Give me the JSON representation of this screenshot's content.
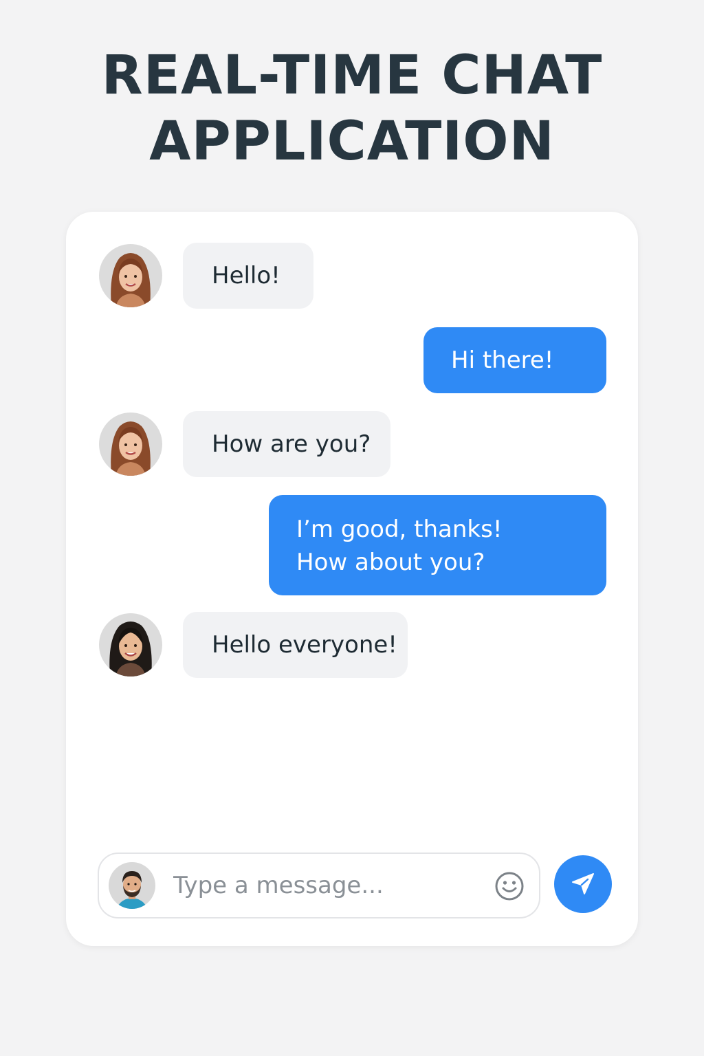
{
  "page": {
    "title_line1": "REAL-TIME CHAT",
    "title_line2": "APPLICATION"
  },
  "colors": {
    "background": "#f3f3f4",
    "card": "#ffffff",
    "incoming_bubble": "#f1f2f4",
    "outgoing_bubble": "#2f8af5",
    "title": "#273640",
    "send_button": "#2f8af5"
  },
  "messages": [
    {
      "direction": "incoming",
      "avatar": "woman-auburn-hair-avatar",
      "text": "Hello!"
    },
    {
      "direction": "outgoing",
      "text": "Hi there!"
    },
    {
      "direction": "incoming",
      "avatar": "woman-auburn-hair-avatar",
      "text": "How are you?"
    },
    {
      "direction": "outgoing",
      "lines": [
        "I’m good, thanks!",
        "How about you?"
      ]
    },
    {
      "direction": "incoming",
      "avatar": "woman-dark-hair-avatar",
      "text": "Hello everyone!"
    }
  ],
  "composer": {
    "placeholder": "Type a message...",
    "value": "",
    "avatar": "man-bearded-avatar",
    "emoji_icon": "smiley-face-icon",
    "send_icon": "paper-plane-icon"
  }
}
